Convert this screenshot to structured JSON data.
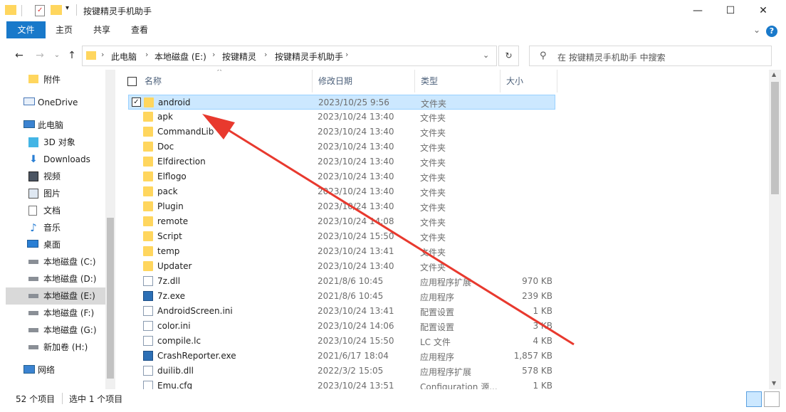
{
  "window": {
    "title": "按键精灵手机助手",
    "minimize": "—",
    "maximize": "☐",
    "close": "✕"
  },
  "ribbon": {
    "tabs": [
      "文件",
      "主页",
      "共享",
      "查看"
    ],
    "expand": "⌄",
    "help": "?"
  },
  "address": {
    "crumbs": [
      "此电脑",
      "本地磁盘 (E:)",
      "按键精灵",
      "按键精灵手机助手"
    ],
    "search_placeholder": "在 按键精灵手机助手 中搜索"
  },
  "sidebar": {
    "items": [
      {
        "label": "附件",
        "icon": "folder-icon"
      },
      {
        "label": "OneDrive",
        "icon": "onedrive-icon"
      },
      {
        "label": "此电脑",
        "icon": "computer-icon"
      },
      {
        "label": "3D 对象",
        "icon": "3d-objects-icon"
      },
      {
        "label": "Downloads",
        "icon": "downloads-icon"
      },
      {
        "label": "视频",
        "icon": "video-icon"
      },
      {
        "label": "图片",
        "icon": "pictures-icon"
      },
      {
        "label": "文档",
        "icon": "documents-icon"
      },
      {
        "label": "音乐",
        "icon": "music-icon"
      },
      {
        "label": "桌面",
        "icon": "desktop-icon"
      },
      {
        "label": "本地磁盘 (C:)",
        "icon": "drive-icon"
      },
      {
        "label": "本地磁盘 (D:)",
        "icon": "drive-icon"
      },
      {
        "label": "本地磁盘 (E:)",
        "icon": "drive-icon"
      },
      {
        "label": "本地磁盘 (F:)",
        "icon": "drive-icon"
      },
      {
        "label": "本地磁盘 (G:)",
        "icon": "drive-icon"
      },
      {
        "label": "新加卷 (H:)",
        "icon": "drive-icon"
      },
      {
        "label": "网络",
        "icon": "network-icon"
      }
    ],
    "selected": "本地磁盘 (E:)"
  },
  "columns": {
    "name": "名称",
    "date": "修改日期",
    "type": "类型",
    "size": "大小"
  },
  "files": [
    {
      "name": "android",
      "date": "2023/10/25 9:56",
      "type": "文件夹",
      "size": "",
      "kind": "folder",
      "selected": true
    },
    {
      "name": "apk",
      "date": "2023/10/24 13:40",
      "type": "文件夹",
      "size": "",
      "kind": "folder"
    },
    {
      "name": "CommandLib",
      "date": "2023/10/24 13:40",
      "type": "文件夹",
      "size": "",
      "kind": "folder"
    },
    {
      "name": "Doc",
      "date": "2023/10/24 13:40",
      "type": "文件夹",
      "size": "",
      "kind": "folder"
    },
    {
      "name": "Elfdirection",
      "date": "2023/10/24 13:40",
      "type": "文件夹",
      "size": "",
      "kind": "folder"
    },
    {
      "name": "Elflogo",
      "date": "2023/10/24 13:40",
      "type": "文件夹",
      "size": "",
      "kind": "folder"
    },
    {
      "name": "pack",
      "date": "2023/10/24 13:40",
      "type": "文件夹",
      "size": "",
      "kind": "folder"
    },
    {
      "name": "Plugin",
      "date": "2023/10/24 13:40",
      "type": "文件夹",
      "size": "",
      "kind": "folder"
    },
    {
      "name": "remote",
      "date": "2023/10/24 14:08",
      "type": "文件夹",
      "size": "",
      "kind": "folder"
    },
    {
      "name": "Script",
      "date": "2023/10/24 15:50",
      "type": "文件夹",
      "size": "",
      "kind": "folder"
    },
    {
      "name": "temp",
      "date": "2023/10/24 13:41",
      "type": "文件夹",
      "size": "",
      "kind": "folder"
    },
    {
      "name": "Updater",
      "date": "2023/10/24 13:40",
      "type": "文件夹",
      "size": "",
      "kind": "folder"
    },
    {
      "name": "7z.dll",
      "date": "2021/8/6 10:45",
      "type": "应用程序扩展",
      "size": "970 KB",
      "kind": "file"
    },
    {
      "name": "7z.exe",
      "date": "2021/8/6 10:45",
      "type": "应用程序",
      "size": "239 KB",
      "kind": "exe"
    },
    {
      "name": "AndroidScreen.ini",
      "date": "2023/10/24 13:41",
      "type": "配置设置",
      "size": "1 KB",
      "kind": "file"
    },
    {
      "name": "color.ini",
      "date": "2023/10/24 14:06",
      "type": "配置设置",
      "size": "3 KB",
      "kind": "file"
    },
    {
      "name": "compile.lc",
      "date": "2023/10/24 15:50",
      "type": "LC 文件",
      "size": "4 KB",
      "kind": "file"
    },
    {
      "name": "CrashReporter.exe",
      "date": "2021/6/17 18:04",
      "type": "应用程序",
      "size": "1,857 KB",
      "kind": "exe"
    },
    {
      "name": "duilib.dll",
      "date": "2022/3/2 15:05",
      "type": "应用程序扩展",
      "size": "578 KB",
      "kind": "file"
    },
    {
      "name": "Emu.cfg",
      "date": "2023/10/24 13:51",
      "type": "Configuration 源...",
      "size": "1 KB",
      "kind": "file"
    }
  ],
  "status": {
    "count": "52 个项目",
    "selected": "选中 1 个项目"
  },
  "colors": {
    "accent": "#1979ca",
    "selection": "#cce8ff",
    "arrow": "#e8392e"
  }
}
